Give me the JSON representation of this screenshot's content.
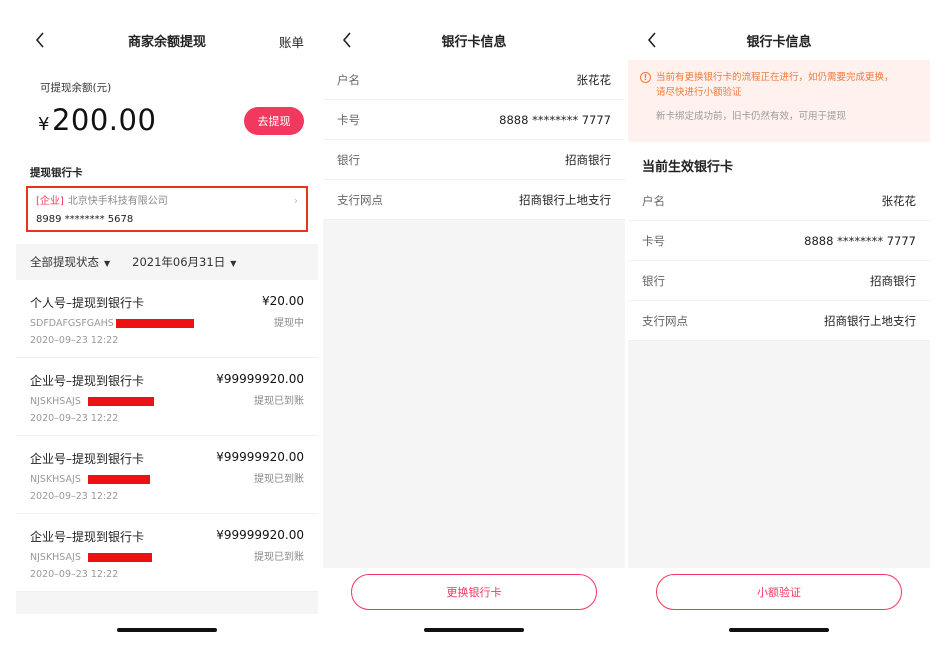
{
  "screen1": {
    "title": "商家余额提现",
    "bill_link": "账单",
    "balance_label": "可提现余额(元)",
    "currency": "¥",
    "balance": "200.00",
    "withdraw_button": "去提现",
    "card_section_label": "提现银行卡",
    "card_tag": "[企业]",
    "card_company": "北京快手科技有限公司",
    "card_number": "8989 ******** 5678",
    "filter_status": "全部提现状态",
    "filter_date": "2021年06月31日",
    "records": [
      {
        "title": "个人号–提现到银行卡",
        "amount": "¥20.00",
        "id": "SDFDAFGSFGAHS",
        "status": "提现中",
        "time": "2020–09–23 12:22"
      },
      {
        "title": "企业号–提现到银行卡",
        "amount": "¥99999920.00",
        "id": "NJSKHSAJS",
        "status": "提现已到账",
        "time": "2020–09–23 12:22"
      },
      {
        "title": "企业号–提现到银行卡",
        "amount": "¥99999920.00",
        "id": "NJSKHSAJS",
        "status": "提现已到账",
        "time": "2020–09–23 12:22"
      },
      {
        "title": "企业号–提现到银行卡",
        "amount": "¥99999920.00",
        "id": "NJSKHSAJS",
        "status": "提现已到账",
        "time": "2020–09–23 12:22"
      }
    ]
  },
  "screen2": {
    "title": "银行卡信息",
    "rows": [
      {
        "label": "户名",
        "value": "张花花"
      },
      {
        "label": "卡号",
        "value": "8888 ******** 7777"
      },
      {
        "label": "银行",
        "value": "招商银行"
      },
      {
        "label": "支行网点",
        "value": "招商银行上地支行"
      }
    ],
    "change_button": "更换银行卡"
  },
  "screen3": {
    "title": "银行卡信息",
    "notice_line1": "当前有更换银行卡的流程正在进行，如仍需要完成更换，",
    "notice_line2": "请尽快进行小额验证",
    "notice_sub": "新卡绑定成功前，旧卡仍然有效，可用于提现",
    "current_card_title": "当前生效银行卡",
    "rows": [
      {
        "label": "户名",
        "value": "张花花"
      },
      {
        "label": "卡号",
        "value": "8888 ******** 7777"
      },
      {
        "label": "银行",
        "value": "招商银行"
      },
      {
        "label": "支行网点",
        "value": "招商银行上地支行"
      }
    ],
    "verify_button": "小额验证"
  },
  "icons": {
    "back": "chevron-left-icon",
    "card_arrow": "chevron-right-icon",
    "dropdown": "caret-down-icon",
    "notice": "info-circle-icon"
  },
  "colors": {
    "accent": "#f2385e",
    "highlight_border": "#e8341c",
    "redaction": "#ee1111",
    "notice_text": "#f07a3c",
    "notice_bg": "#fff2ee"
  }
}
